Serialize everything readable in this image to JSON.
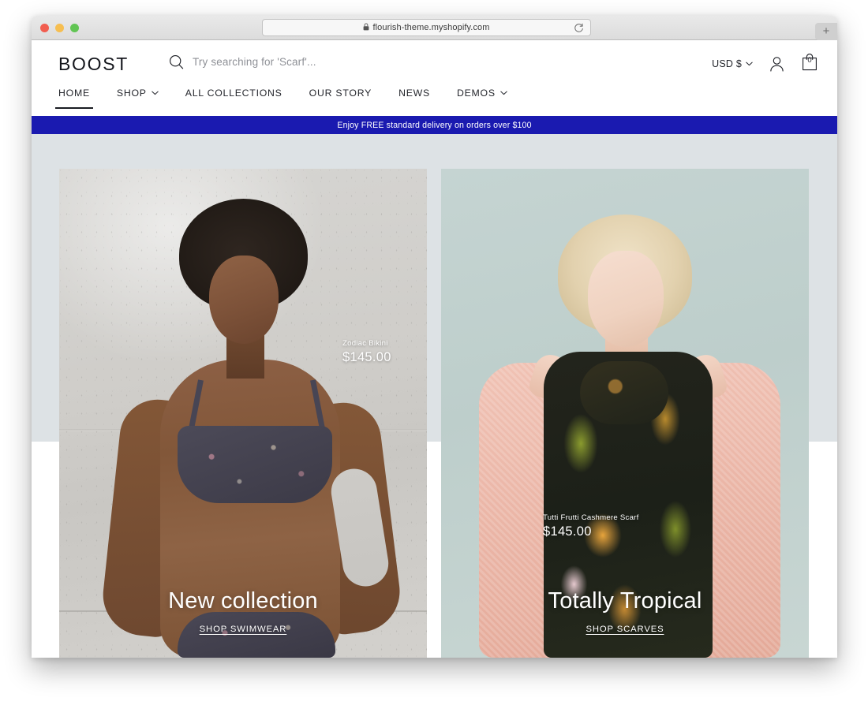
{
  "browser": {
    "url": "flourish-theme.myshopify.com",
    "lock_icon": "lock-icon",
    "reload_icon": "reload-icon",
    "new_tab_label": "+",
    "traffic_lights": [
      "close",
      "minimize",
      "zoom"
    ]
  },
  "header": {
    "logo": "BOOST",
    "search": {
      "icon": "search-icon",
      "placeholder": "Try searching for 'Scarf'...",
      "value": ""
    },
    "currency": {
      "label": "USD $",
      "chevron_icon": "chevron-down-icon"
    },
    "account_icon": "user-icon",
    "cart": {
      "icon": "shopping-bag-icon",
      "count": "0"
    }
  },
  "nav": {
    "items": [
      {
        "label": "HOME",
        "active": true,
        "has_dropdown": false
      },
      {
        "label": "SHOP",
        "active": false,
        "has_dropdown": true
      },
      {
        "label": "ALL COLLECTIONS",
        "active": false,
        "has_dropdown": false
      },
      {
        "label": "OUR STORY",
        "active": false,
        "has_dropdown": false
      },
      {
        "label": "NEWS",
        "active": false,
        "has_dropdown": false
      },
      {
        "label": "DEMOS",
        "active": false,
        "has_dropdown": true
      }
    ]
  },
  "announcement": {
    "text": "Enjoy FREE standard delivery on orders over $100",
    "background": "#1a1ab0",
    "color": "#ffffff"
  },
  "hero": {
    "band_color": "#dde2e5",
    "cards": [
      {
        "id": "left",
        "product_name": "Zodiac Bikini",
        "product_price": "$145.00",
        "title": "New collection",
        "link_label": "SHOP SWIMWEAR",
        "image_alt": "Model wearing a printed bikini against a concrete wall"
      },
      {
        "id": "right",
        "product_name": "Tutti Frutti Cashmere Scarf",
        "product_price": "$145.00",
        "title": "Totally Tropical",
        "link_label": "SHOP SCARVES",
        "image_alt": "Blonde model wearing a tropical print scarf and pink sweater"
      }
    ]
  }
}
